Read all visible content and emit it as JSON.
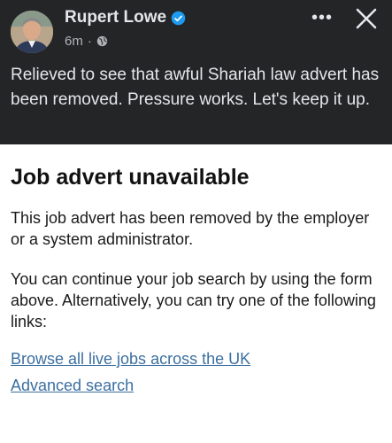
{
  "post": {
    "author": "Rupert Lowe",
    "time": "6m",
    "separator": "·",
    "text": "Relieved to see that awful Shariah law advert has been removed.  Pressure works. Let's keep it up.",
    "more_label": "•••",
    "icons": {
      "verified": "verified-badge-icon",
      "audience": "globe-icon",
      "close": "close-icon"
    },
    "colors": {
      "background": "#242526",
      "verified": "#1d9bf0"
    }
  },
  "page": {
    "heading": "Job advert unavailable",
    "paragraph1": "This job advert has been removed by the employer or a system administrator.",
    "paragraph2": "You can continue your job search by using the form above. Alternatively, you can try one of the following links:",
    "links": [
      "Browse all live jobs across the UK",
      "Advanced search"
    ],
    "colors": {
      "link": "#3b6fa0"
    }
  }
}
